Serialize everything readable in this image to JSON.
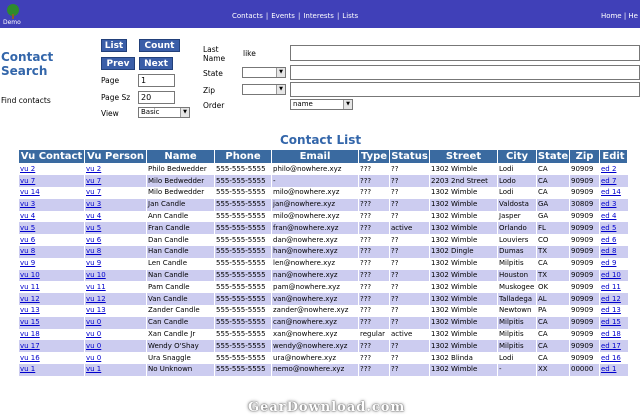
{
  "header": {
    "logo_label": "Demo",
    "nav": [
      "Contacts",
      "Events",
      "Interests",
      "Lists"
    ],
    "right_links": [
      "Home",
      "He"
    ]
  },
  "search": {
    "title_line1": "Contact",
    "title_line2": "Search",
    "find_label": "Find contacts",
    "buttons": {
      "list": "List",
      "count": "Count",
      "prev": "Prev",
      "next": "Next"
    },
    "page_label": "Page",
    "page_value": "1",
    "page_size_label": "Page Sz",
    "page_size_value": "20",
    "view_label": "View",
    "view_value": "Basic",
    "lastname_label_1": "Last",
    "lastname_label_2": "Name",
    "lastname_op": "like",
    "lastname_value": "",
    "state_label": "State",
    "state_value": "",
    "state_text": "",
    "zip_label": "Zip",
    "zip_value": "",
    "zip_text": "",
    "order_label": "Order",
    "order_value": "name"
  },
  "list": {
    "title": "Contact List",
    "columns": [
      "Vu Contact",
      "Vu Person",
      "Name",
      "Phone",
      "Email",
      "Type",
      "Status",
      "Street",
      "City",
      "State",
      "Zip",
      "Edit"
    ],
    "rows": [
      [
        "vu 2",
        "vu 2",
        "Philo Bedwedder",
        "555-555-5555",
        "philo@nowhere.xyz",
        "???",
        "??",
        "1302 Wimble",
        "Lodi",
        "CA",
        "90909",
        "ed 2"
      ],
      [
        "vu 7",
        "vu 7",
        "Milo Bedwedder",
        "555-555-5555",
        "-",
        "???",
        "??",
        "2203 2nd Street",
        "Lodo",
        "CA",
        "90909",
        "ed 7"
      ],
      [
        "vu 14",
        "vu 7",
        "Milo Bedwedder",
        "555-555-5555",
        "milo@nowhere.xyz",
        "???",
        "??",
        "1302 Wimble",
        "Lodi",
        "CA",
        "90909",
        "ed 14"
      ],
      [
        "vu 3",
        "vu 3",
        "Jan Candle",
        "555-555-5555",
        "jan@nowhere.xyz",
        "???",
        "??",
        "1302 Wimble",
        "Valdosta",
        "GA",
        "30809",
        "ed 3"
      ],
      [
        "vu 4",
        "vu 4",
        "Ann Candle",
        "555-555-5555",
        "milo@nowhere.xyz",
        "???",
        "??",
        "1302 Wimble",
        "Jasper",
        "GA",
        "90909",
        "ed 4"
      ],
      [
        "vu 5",
        "vu 5",
        "Fran Candle",
        "555-555-5555",
        "fran@nowhere.xyz",
        "???",
        "active",
        "1302 Wimble",
        "Orlando",
        "FL",
        "90909",
        "ed 5"
      ],
      [
        "vu 6",
        "vu 6",
        "Dan Candle",
        "555-555-5555",
        "dan@nowhere.xyz",
        "???",
        "??",
        "1302 Wimble",
        "Louviers",
        "CO",
        "90909",
        "ed 6"
      ],
      [
        "vu 8",
        "vu 8",
        "Han Candle",
        "555-555-5555",
        "han@nowhere.xyz",
        "???",
        "??",
        "1302 Dingle",
        "Dumas",
        "TX",
        "90909",
        "ed 8"
      ],
      [
        "vu 9",
        "vu 9",
        "Len Candle",
        "555-555-5555",
        "len@nowhere.xyz",
        "???",
        "??",
        "1302 Wimble",
        "Milpitis",
        "CA",
        "90909",
        "ed 9"
      ],
      [
        "vu 10",
        "vu 10",
        "Nan Candle",
        "555-555-5555",
        "nan@nowhere.xyz",
        "???",
        "??",
        "1302 Wimble",
        "Houston",
        "TX",
        "90909",
        "ed 10"
      ],
      [
        "vu 11",
        "vu 11",
        "Pam Candle",
        "555-555-5555",
        "pam@nowhere.xyz",
        "???",
        "??",
        "1302 Wimble",
        "Muskogee",
        "OK",
        "90909",
        "ed 11"
      ],
      [
        "vu 12",
        "vu 12",
        "Van Candle",
        "555-555-5555",
        "van@nowhere.xyz",
        "???",
        "??",
        "1302 Wimble",
        "Talladega",
        "AL",
        "90909",
        "ed 12"
      ],
      [
        "vu 13",
        "vu 13",
        "Zander Candle",
        "555-555-5555",
        "zander@nowhere.xyz",
        "???",
        "??",
        "1302 Wimble",
        "Newtown",
        "PA",
        "90909",
        "ed 13"
      ],
      [
        "vu 15",
        "vu 0",
        "Can Candle",
        "555-555-5555",
        "can@nowhere.xyz",
        "???",
        "??",
        "1302 Wimble",
        "Milpitis",
        "CA",
        "90909",
        "ed 15"
      ],
      [
        "vu 18",
        "vu 0",
        "Xan Candle Jr",
        "555-555-5555",
        "xan@nowhere.xyz",
        "regular",
        "active",
        "1302 Wimble",
        "Milpitis",
        "CA",
        "90909",
        "ed 18"
      ],
      [
        "vu 17",
        "vu 0",
        "Wendy O'Shay",
        "555-555-5555",
        "wendy@nowhere.xyz",
        "???",
        "??",
        "1302 Wimble",
        "Milpitis",
        "CA",
        "90909",
        "ed 17"
      ],
      [
        "vu 16",
        "vu 0",
        "Ura Snaggle",
        "555-555-5555",
        "ura@nowhere.xyz",
        "???",
        "??",
        "1302 Blinda",
        "Lodi",
        "CA",
        "90909",
        "ed 16"
      ],
      [
        "vu 1",
        "vu 1",
        "No Unknown",
        "555-555-5555",
        "nemo@nowhere.xyz",
        "???",
        "??",
        "1302 Wimble",
        "-",
        "XX",
        "00000",
        "ed 1"
      ]
    ]
  },
  "watermark": "GearDownload.com"
}
